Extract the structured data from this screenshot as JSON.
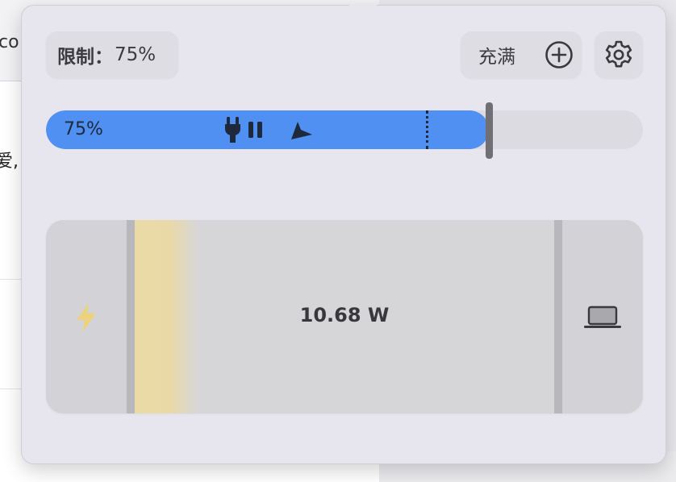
{
  "background": {
    "toolbar_fragment": "co",
    "text_fragment": "爱,"
  },
  "header": {
    "limit_label": "限制：",
    "limit_value": "75%",
    "fill_label": "充满",
    "fill_icon": "plus-circle-icon",
    "settings_icon": "gear-icon"
  },
  "charge_bar": {
    "label": "75%",
    "fill_percent": 75,
    "limit_percent": 75,
    "icons": [
      "plug-icon",
      "pause-icon",
      "arrow-icon"
    ],
    "colors": {
      "fill": "#4f90f2",
      "track": "#dcdbe1"
    }
  },
  "power_flow": {
    "source_icon": "lightning-bolt-icon",
    "wattage": "10.68 W",
    "target_icon": "laptop-icon",
    "colors": {
      "bolt": "#ecd27a",
      "glow": "#ecdaa0"
    }
  }
}
